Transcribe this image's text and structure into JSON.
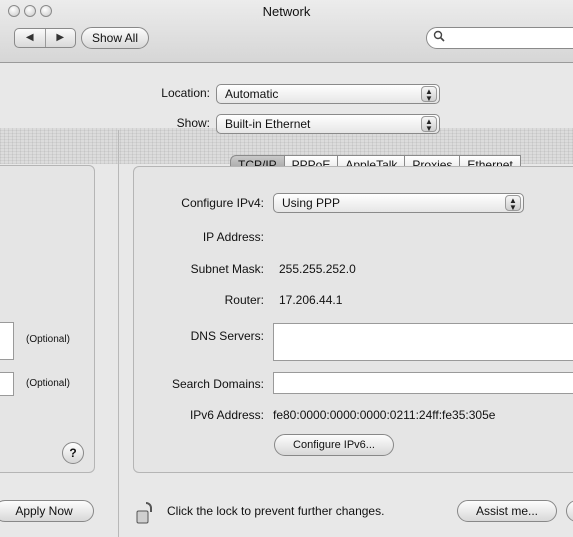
{
  "window": {
    "title": "Network"
  },
  "toolbar": {
    "back_glyph": "◀",
    "forward_glyph": "▶",
    "show_all_label": "Show All",
    "search_value": ""
  },
  "location": {
    "label": "Location:",
    "value": "Automatic"
  },
  "show": {
    "label": "Show:",
    "value": "Built-in Ethernet"
  },
  "tabs": [
    "TCP/IP",
    "PPPoE",
    "AppleTalk",
    "Proxies",
    "Ethernet"
  ],
  "left_panel": {
    "optional_1": "(Optional)",
    "optional_2": "(Optional)",
    "help_label": "?",
    "apply_label": "Apply Now"
  },
  "form": {
    "configure_ipv4_label": "Configure IPv4:",
    "configure_ipv4_value": "Using PPP",
    "ip_address_label": "IP Address:",
    "ip_address_value": "",
    "subnet_mask_label": "Subnet Mask:",
    "subnet_mask_value": "255.255.252.0",
    "router_label": "Router:",
    "router_value": "17.206.44.1",
    "dns_label": "DNS Servers:",
    "dns_value": "",
    "search_domains_label": "Search Domains:",
    "search_domains_value": "",
    "ipv6_label": "IPv6 Address:",
    "ipv6_value": "fe80:0000:0000:0000:0211:24ff:fe35:305e",
    "configure_ipv6_label": "Configure IPv6..."
  },
  "footer": {
    "lock_text": "Click the lock to prevent further changes.",
    "assist_label": "Assist me..."
  }
}
